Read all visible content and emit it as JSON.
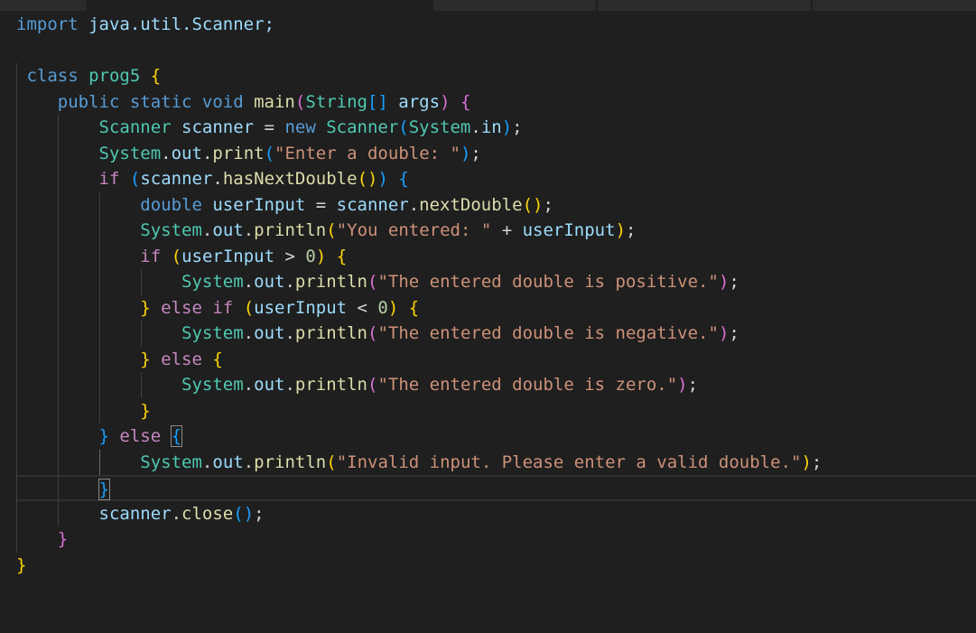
{
  "colors": {
    "keyword_blue": "#569cd6",
    "keyword_purple": "#c586c0",
    "type_teal": "#4ec9b0",
    "identifier": "#9cdcfe",
    "function": "#dcdcaa",
    "string": "#ce9178",
    "number": "#b5cea8",
    "punct": "#d4d4d4",
    "bracket_gold": "#ffd700",
    "bracket_pink": "#da70d6",
    "bracket_blue": "#179fff"
  },
  "code": {
    "lines": [
      [
        {
          "t": "import",
          "c": "keyword_blue"
        },
        {
          "t": " java.util.Scanner;",
          "c": "identifier"
        }
      ],
      [],
      [
        {
          "t": " class ",
          "c": "keyword_blue"
        },
        {
          "t": "prog5",
          "c": "type_teal"
        },
        {
          "t": " ",
          "c": "punct"
        },
        {
          "t": "{",
          "c": "bracket_gold"
        }
      ],
      [
        {
          "t": "    public static void ",
          "c": "keyword_blue"
        },
        {
          "t": "main",
          "c": "function"
        },
        {
          "t": "(",
          "c": "bracket_pink"
        },
        {
          "t": "String",
          "c": "type_teal"
        },
        {
          "t": "[]",
          "c": "bracket_blue"
        },
        {
          "t": " args",
          "c": "identifier"
        },
        {
          "t": ")",
          "c": "bracket_pink"
        },
        {
          "t": " ",
          "c": "punct"
        },
        {
          "t": "{",
          "c": "bracket_pink"
        }
      ],
      [
        {
          "t": "        ",
          "c": "punct"
        },
        {
          "t": "Scanner",
          "c": "type_teal"
        },
        {
          "t": " scanner",
          "c": "identifier"
        },
        {
          "t": " = ",
          "c": "punct"
        },
        {
          "t": "new ",
          "c": "keyword_blue"
        },
        {
          "t": "Scanner",
          "c": "type_teal"
        },
        {
          "t": "(",
          "c": "bracket_blue"
        },
        {
          "t": "System",
          "c": "type_teal"
        },
        {
          "t": ".",
          "c": "punct"
        },
        {
          "t": "in",
          "c": "identifier"
        },
        {
          "t": ")",
          "c": "bracket_blue"
        },
        {
          "t": ";",
          "c": "punct"
        }
      ],
      [
        {
          "t": "        ",
          "c": "punct"
        },
        {
          "t": "System",
          "c": "type_teal"
        },
        {
          "t": ".",
          "c": "punct"
        },
        {
          "t": "out",
          "c": "identifier"
        },
        {
          "t": ".",
          "c": "punct"
        },
        {
          "t": "print",
          "c": "function"
        },
        {
          "t": "(",
          "c": "bracket_blue"
        },
        {
          "t": "\"Enter a double: \"",
          "c": "string"
        },
        {
          "t": ")",
          "c": "bracket_blue"
        },
        {
          "t": ";",
          "c": "punct"
        }
      ],
      [
        {
          "t": "        ",
          "c": "punct"
        },
        {
          "t": "if",
          "c": "keyword_purple"
        },
        {
          "t": " ",
          "c": "punct"
        },
        {
          "t": "(",
          "c": "bracket_blue"
        },
        {
          "t": "scanner",
          "c": "identifier"
        },
        {
          "t": ".",
          "c": "punct"
        },
        {
          "t": "hasNextDouble",
          "c": "function"
        },
        {
          "t": "()",
          "c": "bracket_gold"
        },
        {
          "t": ")",
          "c": "bracket_blue"
        },
        {
          "t": " ",
          "c": "punct"
        },
        {
          "t": "{",
          "c": "bracket_blue"
        }
      ],
      [
        {
          "t": "            ",
          "c": "punct"
        },
        {
          "t": "double",
          "c": "keyword_blue"
        },
        {
          "t": " userInput",
          "c": "identifier"
        },
        {
          "t": " = ",
          "c": "punct"
        },
        {
          "t": "scanner",
          "c": "identifier"
        },
        {
          "t": ".",
          "c": "punct"
        },
        {
          "t": "nextDouble",
          "c": "function"
        },
        {
          "t": "()",
          "c": "bracket_gold"
        },
        {
          "t": ";",
          "c": "punct"
        }
      ],
      [
        {
          "t": "            ",
          "c": "punct"
        },
        {
          "t": "System",
          "c": "type_teal"
        },
        {
          "t": ".",
          "c": "punct"
        },
        {
          "t": "out",
          "c": "identifier"
        },
        {
          "t": ".",
          "c": "punct"
        },
        {
          "t": "println",
          "c": "function"
        },
        {
          "t": "(",
          "c": "bracket_gold"
        },
        {
          "t": "\"You entered: \"",
          "c": "string"
        },
        {
          "t": " + ",
          "c": "punct"
        },
        {
          "t": "userInput",
          "c": "identifier"
        },
        {
          "t": ")",
          "c": "bracket_gold"
        },
        {
          "t": ";",
          "c": "punct"
        }
      ],
      [
        {
          "t": "            ",
          "c": "punct"
        },
        {
          "t": "if",
          "c": "keyword_purple"
        },
        {
          "t": " ",
          "c": "punct"
        },
        {
          "t": "(",
          "c": "bracket_gold"
        },
        {
          "t": "userInput",
          "c": "identifier"
        },
        {
          "t": " > ",
          "c": "punct"
        },
        {
          "t": "0",
          "c": "number"
        },
        {
          "t": ")",
          "c": "bracket_gold"
        },
        {
          "t": " ",
          "c": "punct"
        },
        {
          "t": "{",
          "c": "bracket_gold"
        }
      ],
      [
        {
          "t": "                ",
          "c": "punct"
        },
        {
          "t": "System",
          "c": "type_teal"
        },
        {
          "t": ".",
          "c": "punct"
        },
        {
          "t": "out",
          "c": "identifier"
        },
        {
          "t": ".",
          "c": "punct"
        },
        {
          "t": "println",
          "c": "function"
        },
        {
          "t": "(",
          "c": "bracket_pink"
        },
        {
          "t": "\"The entered double is positive.\"",
          "c": "string"
        },
        {
          "t": ")",
          "c": "bracket_pink"
        },
        {
          "t": ";",
          "c": "punct"
        }
      ],
      [
        {
          "t": "            ",
          "c": "punct"
        },
        {
          "t": "}",
          "c": "bracket_gold"
        },
        {
          "t": " else if ",
          "c": "keyword_purple"
        },
        {
          "t": "(",
          "c": "bracket_gold"
        },
        {
          "t": "userInput",
          "c": "identifier"
        },
        {
          "t": " < ",
          "c": "punct"
        },
        {
          "t": "0",
          "c": "number"
        },
        {
          "t": ")",
          "c": "bracket_gold"
        },
        {
          "t": " ",
          "c": "punct"
        },
        {
          "t": "{",
          "c": "bracket_gold"
        }
      ],
      [
        {
          "t": "                ",
          "c": "punct"
        },
        {
          "t": "System",
          "c": "type_teal"
        },
        {
          "t": ".",
          "c": "punct"
        },
        {
          "t": "out",
          "c": "identifier"
        },
        {
          "t": ".",
          "c": "punct"
        },
        {
          "t": "println",
          "c": "function"
        },
        {
          "t": "(",
          "c": "bracket_pink"
        },
        {
          "t": "\"The entered double is negative.\"",
          "c": "string"
        },
        {
          "t": ")",
          "c": "bracket_pink"
        },
        {
          "t": ";",
          "c": "punct"
        }
      ],
      [
        {
          "t": "            ",
          "c": "punct"
        },
        {
          "t": "}",
          "c": "bracket_gold"
        },
        {
          "t": " else ",
          "c": "keyword_purple"
        },
        {
          "t": "{",
          "c": "bracket_gold"
        }
      ],
      [
        {
          "t": "                ",
          "c": "punct"
        },
        {
          "t": "System",
          "c": "type_teal"
        },
        {
          "t": ".",
          "c": "punct"
        },
        {
          "t": "out",
          "c": "identifier"
        },
        {
          "t": ".",
          "c": "punct"
        },
        {
          "t": "println",
          "c": "function"
        },
        {
          "t": "(",
          "c": "bracket_pink"
        },
        {
          "t": "\"The entered double is zero.\"",
          "c": "string"
        },
        {
          "t": ")",
          "c": "bracket_pink"
        },
        {
          "t": ";",
          "c": "punct"
        }
      ],
      [
        {
          "t": "            ",
          "c": "punct"
        },
        {
          "t": "}",
          "c": "bracket_gold"
        }
      ],
      [
        {
          "t": "        ",
          "c": "punct"
        },
        {
          "t": "}",
          "c": "bracket_blue"
        },
        {
          "t": " else ",
          "c": "keyword_purple"
        },
        {
          "t": "{",
          "c": "bracket_blue",
          "box": true
        }
      ],
      [
        {
          "t": "            ",
          "c": "punct"
        },
        {
          "t": "System",
          "c": "type_teal"
        },
        {
          "t": ".",
          "c": "punct"
        },
        {
          "t": "out",
          "c": "identifier"
        },
        {
          "t": ".",
          "c": "punct"
        },
        {
          "t": "println",
          "c": "function"
        },
        {
          "t": "(",
          "c": "bracket_gold"
        },
        {
          "t": "\"Invalid input. Please enter a valid double.\"",
          "c": "string"
        },
        {
          "t": ")",
          "c": "bracket_gold"
        },
        {
          "t": ";",
          "c": "punct"
        }
      ],
      [
        {
          "t": "        ",
          "c": "punct"
        },
        {
          "t": "}",
          "c": "bracket_blue",
          "box": true
        }
      ],
      [
        {
          "t": "        ",
          "c": "punct"
        },
        {
          "t": "scanner",
          "c": "identifier"
        },
        {
          "t": ".",
          "c": "punct"
        },
        {
          "t": "close",
          "c": "function"
        },
        {
          "t": "()",
          "c": "bracket_blue"
        },
        {
          "t": ";",
          "c": "punct"
        }
      ],
      [
        {
          "t": "    ",
          "c": "punct"
        },
        {
          "t": "}",
          "c": "bracket_pink"
        }
      ],
      [
        {
          "t": "}",
          "c": "bracket_gold"
        }
      ]
    ],
    "current_line_index": 18
  }
}
